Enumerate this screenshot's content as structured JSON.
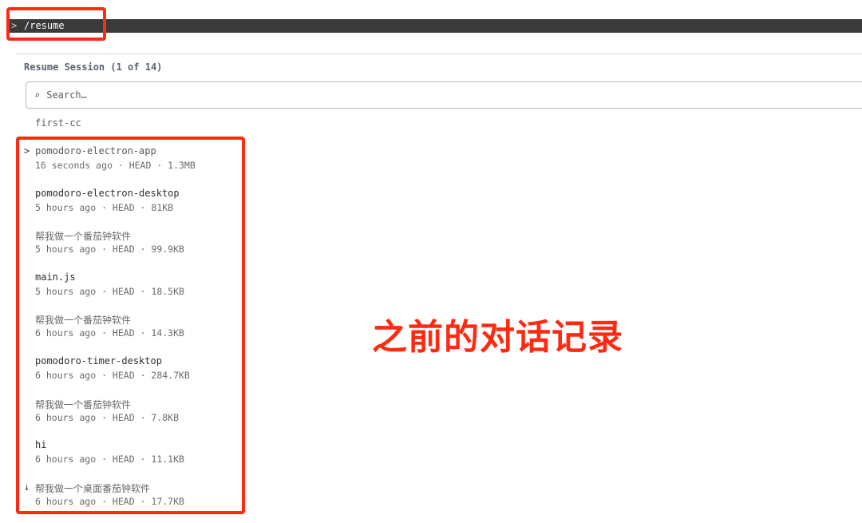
{
  "command_bar": {
    "prompt": ">",
    "command": "/resume"
  },
  "panel": {
    "title": "Resume Session (1 of 14)",
    "search_icon": "⌕",
    "search_placeholder": "Search…",
    "first_item": "first-cc"
  },
  "sessions": [
    {
      "title": "pomodoro-electron-app",
      "meta": "16 seconds ago · HEAD · 1.3MB",
      "marker": ">"
    },
    {
      "title": "pomodoro-electron-desktop",
      "meta": "5 hours ago · HEAD · 81KB",
      "marker": ""
    },
    {
      "title": "帮我做一个番茄钟软件",
      "meta": "5 hours ago · HEAD · 99.9KB",
      "marker": ""
    },
    {
      "title": "main.js",
      "meta": "5 hours ago · HEAD · 18.5KB",
      "marker": ""
    },
    {
      "title": "帮我做一个番茄钟软件",
      "meta": "6 hours ago · HEAD · 14.3KB",
      "marker": ""
    },
    {
      "title": "pomodoro-timer-desktop",
      "meta": "6 hours ago · HEAD · 284.7KB",
      "marker": ""
    },
    {
      "title": "帮我做一个番茄钟软件",
      "meta": "6 hours ago · HEAD · 7.8KB",
      "marker": ""
    },
    {
      "title": "hi",
      "meta": "6 hours ago · HEAD · 11.1KB",
      "marker": ""
    },
    {
      "title": "帮我做一个桌面番茄钟软件",
      "meta": "6 hours ago · HEAD · 17.7KB",
      "marker": "↓"
    }
  ],
  "annotation": {
    "label": "之前的对话记录",
    "color": "#ff2a12"
  }
}
